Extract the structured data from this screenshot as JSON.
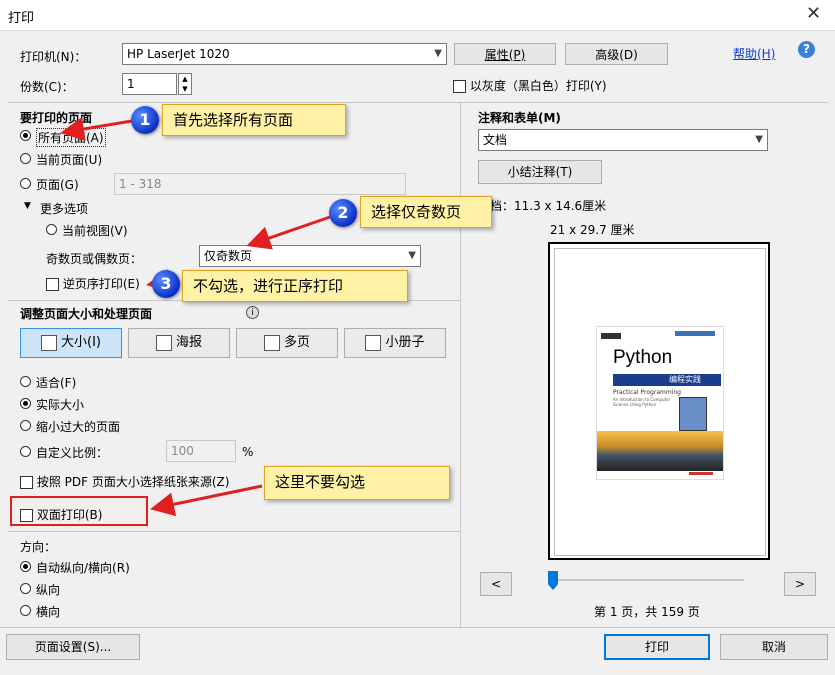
{
  "window": {
    "title": "打印"
  },
  "printer": {
    "label": "打印机(N)：",
    "value": "HP LaserJet 1020",
    "properties": "属性(P)",
    "advanced": "高级(D)",
    "help": "帮助(H)"
  },
  "copies": {
    "label": "份数(C)：",
    "value": "1",
    "grayscale": "以灰度（黑白色）打印(Y)"
  },
  "pages": {
    "title": "要打印的页面",
    "all": "所有页面(A)",
    "current": "当前页面(U)",
    "range_label": "页面(G)",
    "range_value": "1 - 318",
    "more": "更多选项",
    "current_view": "当前视图(V)",
    "odd_even_label": "奇数页或偶数页：",
    "odd_even_value": "仅奇数页",
    "reverse": "逆页序打印(E)"
  },
  "sizing": {
    "title": "调整页面大小和处理页面",
    "tools": [
      "大小(I)",
      "海报",
      "多页",
      "小册子"
    ],
    "fit": "适合(F)",
    "actual": "实际大小",
    "shrink": "缩小过大的页面",
    "custom": "自定义比例：",
    "custom_value": "100",
    "percent": "%",
    "pdf_source": "按照 PDF 页面大小选择纸张来源(Z)",
    "duplex": "双面打印(B)"
  },
  "orientation": {
    "title": "方向：",
    "auto": "自动纵向/横向(R)",
    "portrait": "纵向",
    "landscape": "横向"
  },
  "comments": {
    "title": "注释和表单(M)",
    "value": "文档",
    "summarize": "小结注释(T)"
  },
  "preview": {
    "doc_size": "文档：11.3 x 14.6厘米",
    "paper_size": "21 x 29.7 厘米",
    "book_title": "Python",
    "book_subtitle": "编程实践",
    "book_en": "Practical Programming",
    "book_en2": "An Introduction to Computer",
    "book_en3": "Science Using Python",
    "prev": "<",
    "next": ">",
    "page_info": "第 1 页，共 159 页",
    "slider_fraction": 0
  },
  "footer": {
    "page_setup": "页面设置(S)...",
    "print": "打印",
    "cancel": "取消"
  },
  "annotations": [
    {
      "num": "1",
      "text": "首先选择所有页面"
    },
    {
      "num": "2",
      "text": "选择仅奇数页"
    },
    {
      "num": "3",
      "text": "不勾选，进行正序打印"
    },
    {
      "num": "",
      "text": "这里不要勾选"
    }
  ],
  "colors": {
    "accent": "#0078d7",
    "callout": "#fff2a6",
    "arrow": "#e02020",
    "badge": "#0a2fc8"
  }
}
